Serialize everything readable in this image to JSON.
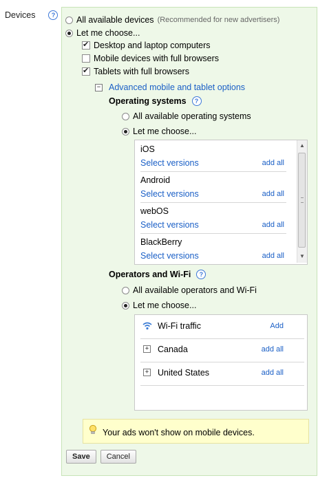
{
  "devices_label": "Devices",
  "help_glyph": "?",
  "device_radio": {
    "all_label": "All available devices",
    "all_note": "(Recommended for new advertisers)",
    "choose_label": "Let me choose..."
  },
  "device_checkboxes": [
    {
      "label": "Desktop and laptop computers",
      "checked": true
    },
    {
      "label": "Mobile devices with full browsers",
      "checked": false
    },
    {
      "label": "Tablets with full browsers",
      "checked": true
    }
  ],
  "advanced": {
    "toggle_glyph": "−",
    "label": "Advanced mobile and tablet options"
  },
  "operating_systems": {
    "heading": "Operating systems",
    "all_label": "All available operating systems",
    "choose_label": "Let me choose...",
    "items": [
      {
        "name": "iOS",
        "select": "Select versions",
        "add": "add all"
      },
      {
        "name": "Android",
        "select": "Select versions",
        "add": "add all"
      },
      {
        "name": "webOS",
        "select": "Select versions",
        "add": "add all"
      },
      {
        "name": "BlackBerry",
        "select": "Select versions",
        "add": "add all"
      }
    ]
  },
  "operators": {
    "heading": "Operators and Wi-Fi",
    "all_label": "All available operators and Wi-Fi",
    "choose_label": "Let me choose...",
    "items": [
      {
        "icon": "wifi-icon",
        "name": "Wi-Fi traffic",
        "action": "Add"
      },
      {
        "icon": "expand-icon",
        "name": "Canada",
        "action": "add all"
      },
      {
        "icon": "expand-icon",
        "name": "United States",
        "action": "add all"
      }
    ]
  },
  "tip": {
    "icon": "lightbulb-icon",
    "text": "Your ads won't show on mobile devices."
  },
  "buttons": {
    "save": "Save",
    "cancel": "Cancel"
  },
  "colors": {
    "panel_bg": "#eef8e8",
    "link": "#1a5fc6",
    "tip_bg": "#ffffcc"
  }
}
